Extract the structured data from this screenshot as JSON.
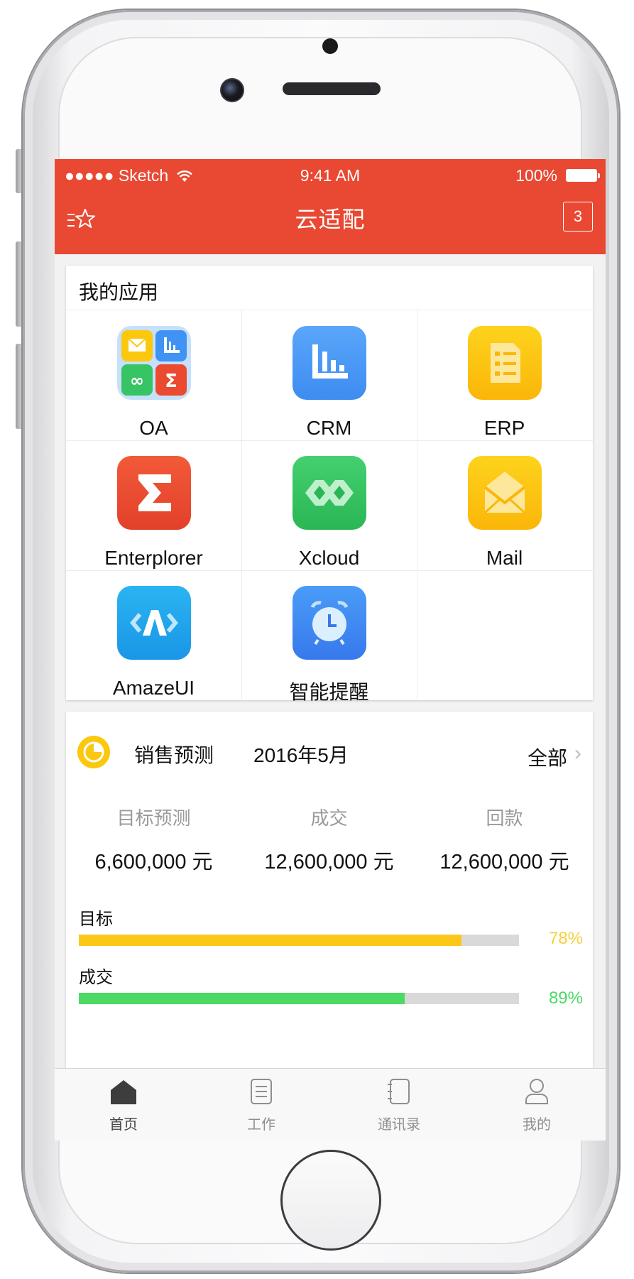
{
  "status_bar": {
    "carrier": "●●●●● Sketch",
    "time": "9:41 AM",
    "battery": "100%"
  },
  "nav": {
    "title": "云适配",
    "left_icon": "star-list-icon",
    "badge": "3"
  },
  "apps": {
    "title": "我的应用",
    "items": [
      {
        "label": "OA",
        "icon": "oa-icon"
      },
      {
        "label": "CRM",
        "icon": "crm-chart-icon"
      },
      {
        "label": "ERP",
        "icon": "erp-checklist-icon"
      },
      {
        "label": "Enterplorer",
        "icon": "enterplorer-sigma-icon"
      },
      {
        "label": "Xcloud",
        "icon": "xcloud-icon"
      },
      {
        "label": "Mail",
        "icon": "mail-icon"
      },
      {
        "label": "AmazeUI",
        "icon": "amazeui-icon"
      },
      {
        "label": "智能提醒",
        "icon": "alarm-clock-icon"
      }
    ]
  },
  "sales": {
    "title": "销售预测",
    "date": "2016年5月",
    "filter": "全部",
    "stats": [
      {
        "label": "目标预测",
        "value": "6,600,000 元"
      },
      {
        "label": "成交",
        "value": "12,600,000 元"
      },
      {
        "label": "回款",
        "value": "12,600,000 元"
      }
    ],
    "bars": [
      {
        "label": "目标",
        "percent_text": "78%",
        "fill": 0.87,
        "color": "#fbc81a",
        "text_color": "#f6cf3c"
      },
      {
        "label": "成交",
        "percent_text": "89%",
        "fill": 0.74,
        "color": "#4cd964",
        "text_color": "#4cd964"
      }
    ]
  },
  "tabbar": {
    "tabs": [
      {
        "label": "首页",
        "icon": "home-icon",
        "active": true
      },
      {
        "label": "工作",
        "icon": "document-icon",
        "active": false
      },
      {
        "label": "通讯录",
        "icon": "contacts-icon",
        "active": false
      },
      {
        "label": "我的",
        "icon": "person-icon",
        "active": false
      }
    ]
  },
  "colors": {
    "brand_red": "#e94832",
    "accent_yellow": "#fbc80e",
    "accent_green": "#4cd964"
  }
}
